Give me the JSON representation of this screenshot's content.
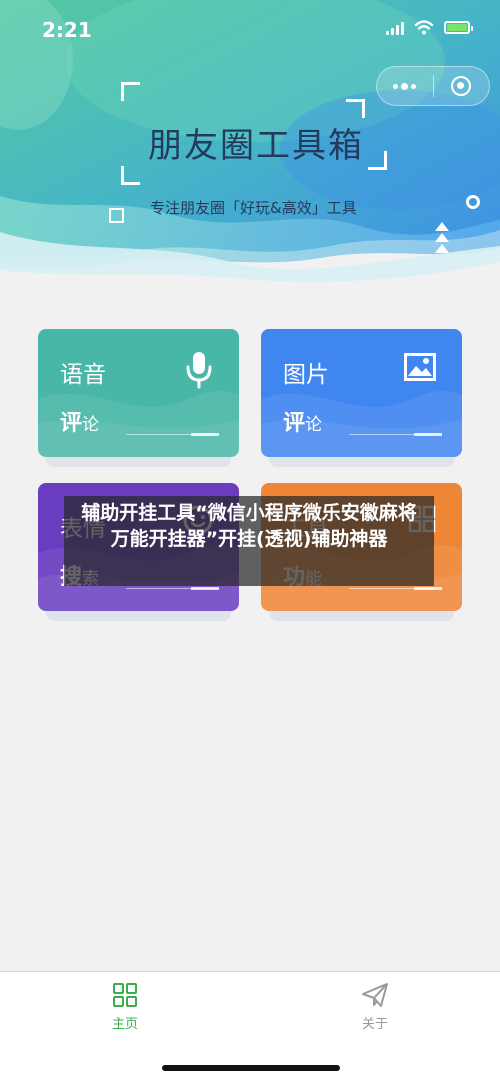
{
  "status": {
    "time": "2:21"
  },
  "brand": {
    "title": "朋友圈工具箱",
    "subtitle": "专注朋友圈「好玩&高效」工具"
  },
  "cards": [
    {
      "title": "语音",
      "sub_bold": "评",
      "sub_rest": "论",
      "icon": "microphone-icon",
      "color": "#48b7a8"
    },
    {
      "title": "图片",
      "sub_bold": "评",
      "sub_rest": "论",
      "icon": "image-icon",
      "color": "#3f86f0"
    },
    {
      "title": "表情",
      "sub_bold": "搜",
      "sub_rest": "索",
      "icon": "emoji-icon",
      "color": "#6a3cc0"
    },
    {
      "title": "工具",
      "sub_bold": "功",
      "sub_rest": "能",
      "icon": "grid-icon",
      "color": "#ee8636"
    }
  ],
  "banner": {
    "text": "辅助开挂工具“微信小程序微乐安徽麻将万能开挂器”开挂(透视)辅助神器"
  },
  "tabs": [
    {
      "label": "主页",
      "icon": "grid-icon",
      "active": true,
      "color": "#3aae4f"
    },
    {
      "label": "关于",
      "icon": "paper-plane-icon",
      "active": false,
      "color": "#999999"
    }
  ]
}
